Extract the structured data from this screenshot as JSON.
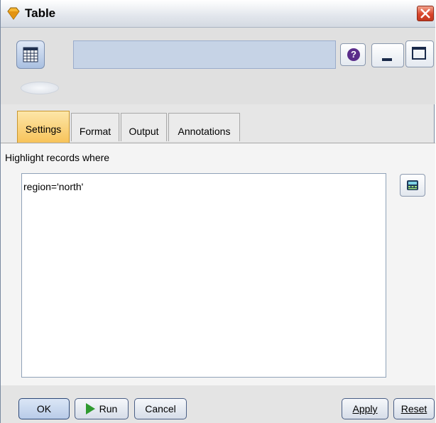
{
  "window": {
    "title": "Table"
  },
  "toolbar": {
    "node_name": "",
    "help_glyph": "?"
  },
  "tabs": [
    {
      "label": "Settings",
      "active": true
    },
    {
      "label": "Format",
      "active": false
    },
    {
      "label": "Output",
      "active": false
    },
    {
      "label": "Annotations",
      "active": false
    }
  ],
  "settings": {
    "label": "Highlight records where",
    "expression": "region='north'"
  },
  "buttons": {
    "ok": "OK",
    "run": "Run",
    "cancel": "Cancel",
    "apply": "Apply",
    "reset": "Reset"
  },
  "colors": {
    "active_tab": "#f7c35a",
    "run_arrow": "#2f9a2f",
    "close_button": "#d9452b"
  }
}
